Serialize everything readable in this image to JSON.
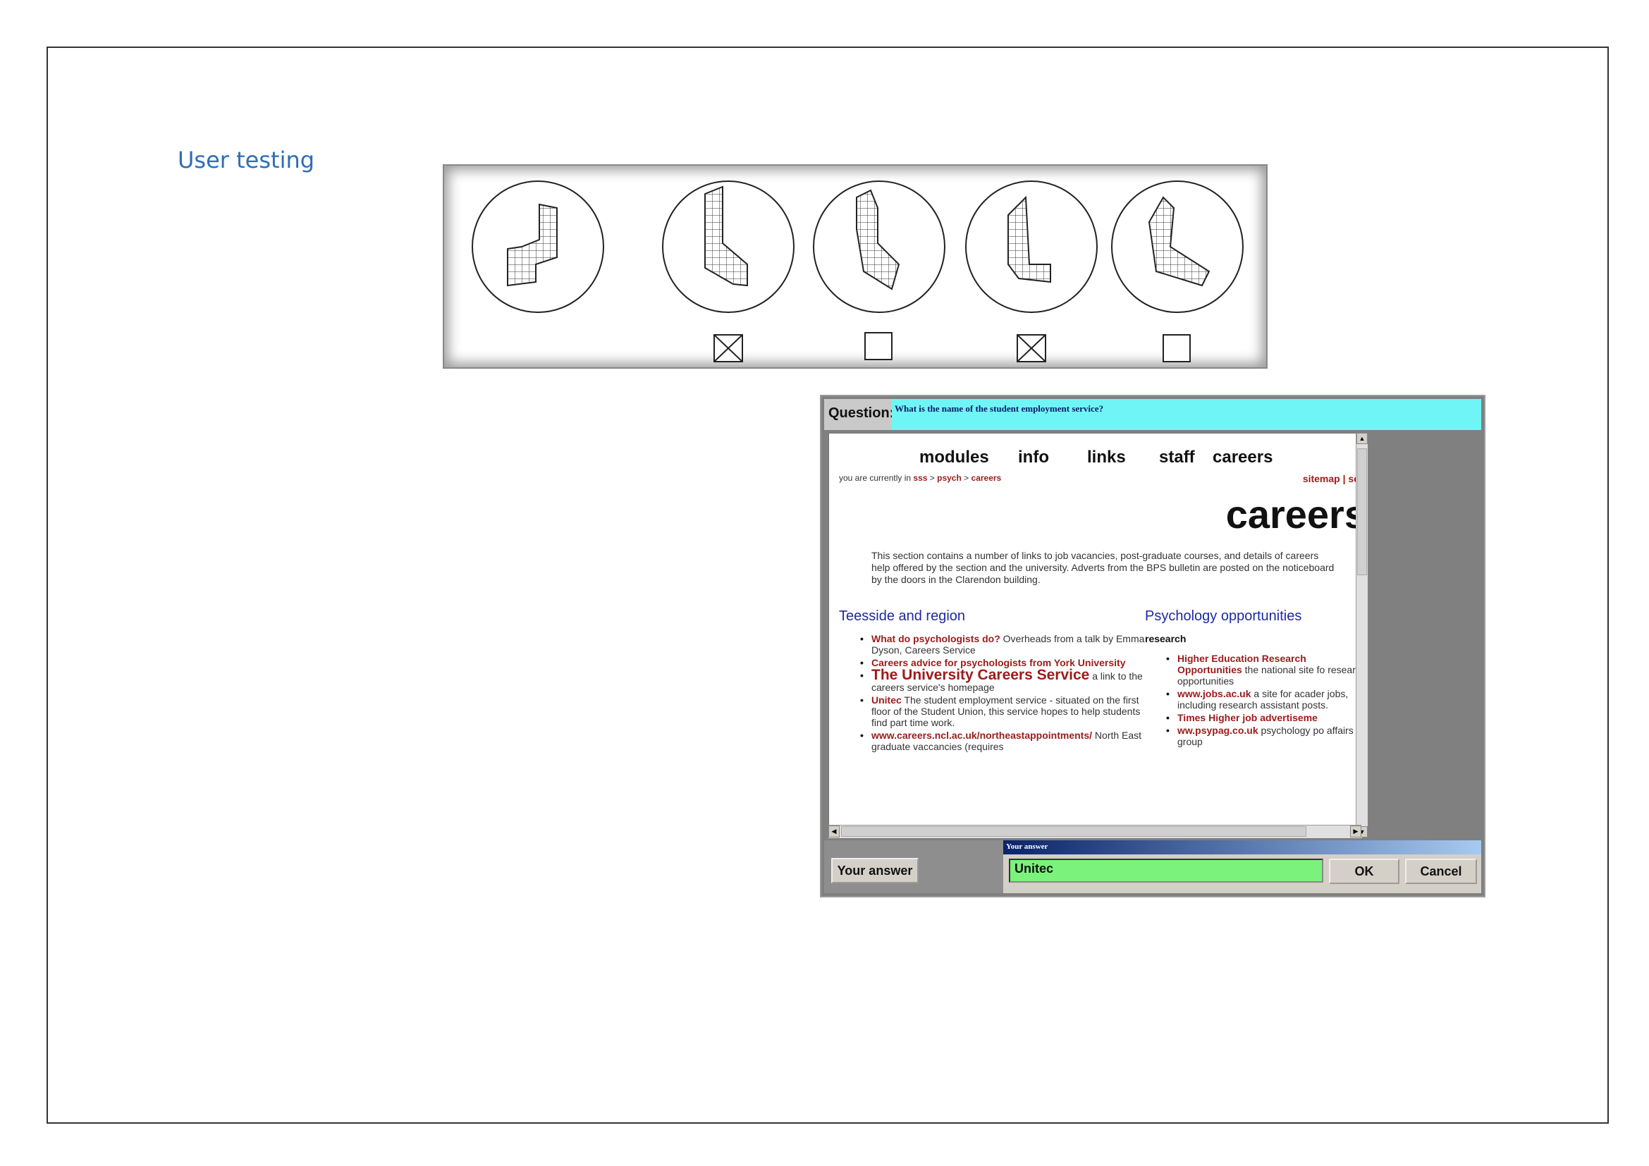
{
  "slide": {
    "title": "User testing"
  },
  "rotation_test": {
    "options": [
      {
        "role": "reference"
      },
      {
        "role": "option",
        "checked": true
      },
      {
        "role": "option",
        "checked": false
      },
      {
        "role": "option",
        "checked": true
      },
      {
        "role": "option",
        "checked": false
      }
    ]
  },
  "quiz": {
    "question_label": "Question:",
    "question_text": "What is the name of the student employment service?",
    "page": {
      "nav": [
        "modules",
        "info",
        "links",
        "staff",
        "careers"
      ],
      "breadcrumb_prefix": "you are currently in",
      "breadcrumb": [
        "sss",
        "psych",
        "careers"
      ],
      "breadcrumb_separator": ">",
      "sitemap": "sitemap | se",
      "heading": "careers",
      "intro": "This section contains a number of links to job vacancies, post-graduate courses, and details of careers help offered by the section and the university. Adverts from the BPS bulletin are posted on the noticeboard by the doors in the Clarendon building.",
      "left_column": {
        "heading": "Teesside and region",
        "items": [
          {
            "link": "What do psychologists do?",
            "text": " Overheads from a talk by Emma Dyson, Careers Service"
          },
          {
            "link": "Careers advice for psychologists from York University",
            "text": ""
          },
          {
            "link": "The University Careers Service",
            "text": " a link to the careers service's homepage",
            "large": true
          },
          {
            "link": "Unitec",
            "text": " The student employment service - situated on the first floor of the Student Union, this service hopes to help students find part time work."
          },
          {
            "link": "www.careers.ncl.ac.uk/northeastappointments/",
            "text": " North East graduate vaccancies (requires"
          }
        ]
      },
      "right_column": {
        "heading": "Psychology opportunities",
        "subheading": "research",
        "items": [
          {
            "link": "Higher Education Research Opportunities",
            "text": " the national site fo research opportunities"
          },
          {
            "link": "www.jobs.ac.uk",
            "text": " a site for acader jobs, including research assistant posts."
          },
          {
            "link": "Times Higher job advertiseme",
            "text": ""
          },
          {
            "link": "ww.psypag.co.uk",
            "text": " psychology po affairs group"
          }
        ]
      }
    },
    "your_answer_button": "Your answer",
    "dialog_title": "Your answer",
    "answer_value": "Unitec",
    "ok_label": "OK",
    "cancel_label": "Cancel"
  }
}
